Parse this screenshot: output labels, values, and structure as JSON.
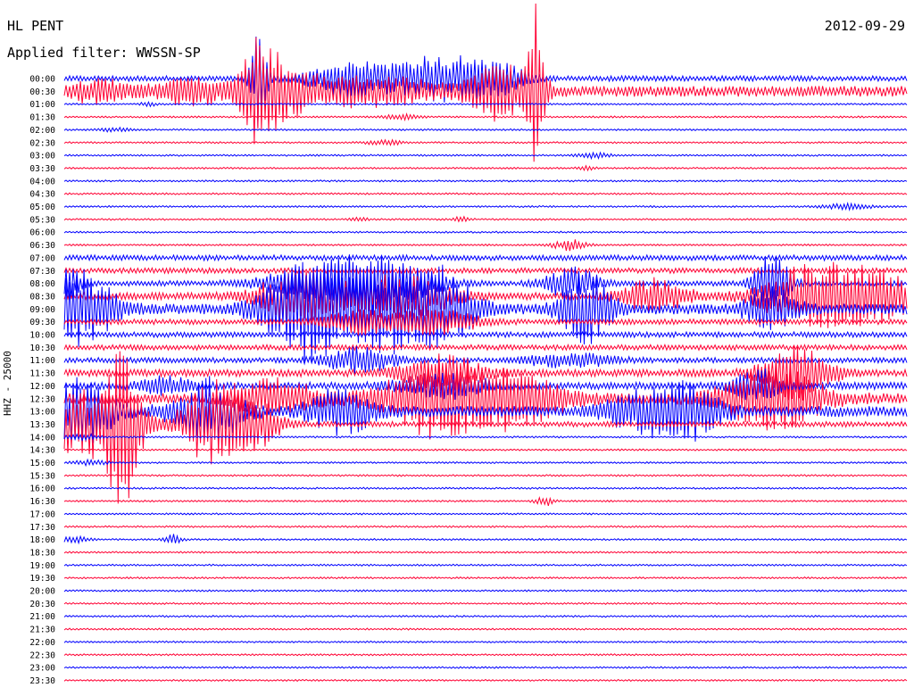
{
  "header": {
    "station": "HL PENT",
    "date": "2012-09-29",
    "filter": "Applied filter: WWSSN-SP"
  },
  "chart_data": {
    "type": "line",
    "title": "HL PENT",
    "date": "2012-09-29",
    "filter": "WWSSN-SP",
    "ylabel": "HHZ - 25000",
    "row_interval_minutes": 30,
    "row_labels": [
      "00:00",
      "00:30",
      "01:00",
      "01:30",
      "02:00",
      "02:30",
      "03:00",
      "03:30",
      "04:00",
      "04:30",
      "05:00",
      "05:30",
      "06:00",
      "06:30",
      "07:00",
      "07:30",
      "08:00",
      "08:30",
      "09:00",
      "09:30",
      "10:00",
      "10:30",
      "11:00",
      "11:30",
      "12:00",
      "12:30",
      "13:00",
      "13:30",
      "14:00",
      "14:30",
      "15:00",
      "15:30",
      "16:00",
      "16:30",
      "17:00",
      "17:30",
      "18:00",
      "18:30",
      "19:00",
      "19:30",
      "20:00",
      "20:30",
      "21:00",
      "21:30",
      "22:00",
      "22:30",
      "23:00",
      "23:30"
    ],
    "trace_colors": [
      "#0000ff",
      "#ff0033"
    ],
    "grid": false,
    "row_noise_level": [
      3,
      6,
      1,
      1,
      1,
      1,
      1,
      1,
      1,
      1,
      1,
      1,
      1,
      1,
      3,
      3,
      3,
      4,
      6,
      3,
      3,
      3,
      3,
      4,
      4,
      6,
      6,
      3,
      1,
      1,
      1,
      1,
      1,
      1,
      1,
      1,
      1,
      1,
      1,
      1,
      1,
      1,
      1,
      1,
      1,
      1,
      1,
      1
    ],
    "bursts": [
      {
        "row": 0,
        "t": 0.23,
        "amp": 60,
        "w": 0.01
      },
      {
        "row": 0,
        "t": 0.34,
        "amp": 20,
        "w": 0.05
      },
      {
        "row": 0,
        "t": 0.45,
        "amp": 28,
        "w": 0.06
      },
      {
        "row": 0,
        "t": 0.52,
        "amp": 14,
        "w": 0.03
      },
      {
        "row": 1,
        "t": 0.04,
        "amp": 14,
        "w": 0.03
      },
      {
        "row": 1,
        "t": 0.15,
        "amp": 12,
        "w": 0.05
      },
      {
        "row": 1,
        "t": 0.23,
        "amp": 50,
        "w": 0.02
      },
      {
        "row": 1,
        "t": 0.26,
        "amp": 30,
        "w": 0.04
      },
      {
        "row": 1,
        "t": 0.34,
        "amp": 12,
        "w": 0.04
      },
      {
        "row": 1,
        "t": 0.4,
        "amp": 12,
        "w": 0.05
      },
      {
        "row": 1,
        "t": 0.52,
        "amp": 30,
        "w": 0.04
      },
      {
        "row": 1,
        "t": 0.56,
        "amp": 90,
        "w": 0.01
      },
      {
        "row": 2,
        "t": 0.1,
        "amp": 2,
        "w": 0.01
      },
      {
        "row": 3,
        "t": 0.4,
        "amp": 3,
        "w": 0.02
      },
      {
        "row": 4,
        "t": 0.06,
        "amp": 2,
        "w": 0.02
      },
      {
        "row": 5,
        "t": 0.38,
        "amp": 3,
        "w": 0.02
      },
      {
        "row": 6,
        "t": 0.63,
        "amp": 3,
        "w": 0.02
      },
      {
        "row": 7,
        "t": 0.62,
        "amp": 2,
        "w": 0.01
      },
      {
        "row": 10,
        "t": 0.93,
        "amp": 3,
        "w": 0.03
      },
      {
        "row": 11,
        "t": 0.35,
        "amp": 2,
        "w": 0.01
      },
      {
        "row": 11,
        "t": 0.47,
        "amp": 3,
        "w": 0.01
      },
      {
        "row": 13,
        "t": 0.6,
        "amp": 6,
        "w": 0.02
      },
      {
        "row": 16,
        "t": 0.0,
        "amp": 20,
        "w": 0.02
      },
      {
        "row": 16,
        "t": 0.3,
        "amp": 22,
        "w": 0.06
      },
      {
        "row": 16,
        "t": 0.38,
        "amp": 30,
        "w": 0.06
      },
      {
        "row": 16,
        "t": 0.6,
        "amp": 20,
        "w": 0.03
      },
      {
        "row": 16,
        "t": 0.84,
        "amp": 40,
        "w": 0.02
      },
      {
        "row": 17,
        "t": 0.28,
        "amp": 30,
        "w": 0.05
      },
      {
        "row": 17,
        "t": 0.4,
        "amp": 25,
        "w": 0.06
      },
      {
        "row": 17,
        "t": 0.7,
        "amp": 20,
        "w": 0.04
      },
      {
        "row": 17,
        "t": 0.89,
        "amp": 40,
        "w": 0.06
      },
      {
        "row": 17,
        "t": 0.97,
        "amp": 25,
        "w": 0.04
      },
      {
        "row": 18,
        "t": 0.02,
        "amp": 40,
        "w": 0.04
      },
      {
        "row": 18,
        "t": 0.29,
        "amp": 60,
        "w": 0.05
      },
      {
        "row": 18,
        "t": 0.38,
        "amp": 45,
        "w": 0.05
      },
      {
        "row": 18,
        "t": 0.45,
        "amp": 40,
        "w": 0.04
      },
      {
        "row": 18,
        "t": 0.62,
        "amp": 40,
        "w": 0.03
      },
      {
        "row": 18,
        "t": 0.84,
        "amp": 25,
        "w": 0.03
      },
      {
        "row": 19,
        "t": 0.35,
        "amp": 15,
        "w": 0.04
      },
      {
        "row": 19,
        "t": 0.44,
        "amp": 15,
        "w": 0.05
      },
      {
        "row": 22,
        "t": 0.35,
        "amp": 15,
        "w": 0.04
      },
      {
        "row": 22,
        "t": 0.6,
        "amp": 8,
        "w": 0.05
      },
      {
        "row": 23,
        "t": 0.45,
        "amp": 20,
        "w": 0.05
      },
      {
        "row": 23,
        "t": 0.87,
        "amp": 30,
        "w": 0.04
      },
      {
        "row": 24,
        "t": 0.12,
        "amp": 10,
        "w": 0.03
      },
      {
        "row": 24,
        "t": 0.45,
        "amp": 15,
        "w": 0.05
      },
      {
        "row": 24,
        "t": 0.82,
        "amp": 20,
        "w": 0.03
      },
      {
        "row": 25,
        "t": 0.25,
        "amp": 20,
        "w": 0.05
      },
      {
        "row": 25,
        "t": 0.45,
        "amp": 45,
        "w": 0.07
      },
      {
        "row": 25,
        "t": 0.55,
        "amp": 25,
        "w": 0.05
      },
      {
        "row": 25,
        "t": 0.84,
        "amp": 35,
        "w": 0.06
      },
      {
        "row": 26,
        "t": 0.02,
        "amp": 35,
        "w": 0.04
      },
      {
        "row": 26,
        "t": 0.17,
        "amp": 35,
        "w": 0.04
      },
      {
        "row": 26,
        "t": 0.33,
        "amp": 25,
        "w": 0.04
      },
      {
        "row": 26,
        "t": 0.68,
        "amp": 20,
        "w": 0.04
      },
      {
        "row": 26,
        "t": 0.74,
        "amp": 30,
        "w": 0.04
      },
      {
        "row": 27,
        "t": 0.02,
        "amp": 40,
        "w": 0.06
      },
      {
        "row": 27,
        "t": 0.07,
        "amp": 80,
        "w": 0.02
      },
      {
        "row": 27,
        "t": 0.18,
        "amp": 50,
        "w": 0.04
      },
      {
        "row": 27,
        "t": 0.23,
        "amp": 20,
        "w": 0.03
      },
      {
        "row": 28,
        "t": 0.02,
        "amp": 4,
        "w": 0.02
      },
      {
        "row": 30,
        "t": 0.03,
        "amp": 3,
        "w": 0.02
      },
      {
        "row": 33,
        "t": 0.57,
        "amp": 6,
        "w": 0.01
      },
      {
        "row": 36,
        "t": 0.01,
        "amp": 4,
        "w": 0.02
      },
      {
        "row": 36,
        "t": 0.13,
        "amp": 6,
        "w": 0.01
      }
    ]
  }
}
